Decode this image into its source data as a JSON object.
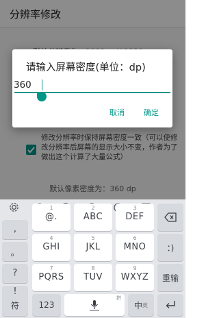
{
  "app": {
    "title": "分辨率修改",
    "bg_resolution": "默认分辨率为：1080px X 1920px",
    "bg_density": "默认像素密度为：360 dp",
    "bg_checkbox_desc": "修改分辨率时保持屏幕密度一致（可以使修改分辨率后屏幕的显示大小不变，作者为了做出这个计算了大量公式）",
    "accent_color": "#009688"
  },
  "dialog": {
    "title": "请输入屏幕密度(单位：dp)",
    "input_value": "360",
    "cancel_label": "取消",
    "ok_label": "确定"
  },
  "keyboard": {
    "toolbar_icons": [
      "gear-icon",
      "text-cursor-icon",
      "emoji-icon",
      "moon-icon",
      "handwriting-icon",
      "table-icon",
      "collapse-icon"
    ],
    "symbols": [
      ",",
      "。",
      "?",
      "!"
    ],
    "keys": [
      {
        "num": "1",
        "main": "@."
      },
      {
        "num": "2",
        "main": "ABC"
      },
      {
        "num": "3",
        "main": "DEF"
      },
      {
        "num": "4",
        "main": "GHI"
      },
      {
        "num": "5",
        "main": "JKL"
      },
      {
        "num": "6",
        "main": "MNO"
      },
      {
        "num": "7",
        "main": "PQRS"
      },
      {
        "num": "8",
        "main": "TUV"
      },
      {
        "num": "9",
        "main": "WXYZ"
      }
    ],
    "backspace_icon": "backspace-icon",
    "colon_key": "：)",
    "relogin_label": "重输",
    "bottom": {
      "symbol_label": "符",
      "numeric_label": "123",
      "space_sub": "拼",
      "space_icon": "microphone-icon",
      "lang_label": "中",
      "lang_sub": "英",
      "enter_icon": "enter-icon"
    }
  }
}
